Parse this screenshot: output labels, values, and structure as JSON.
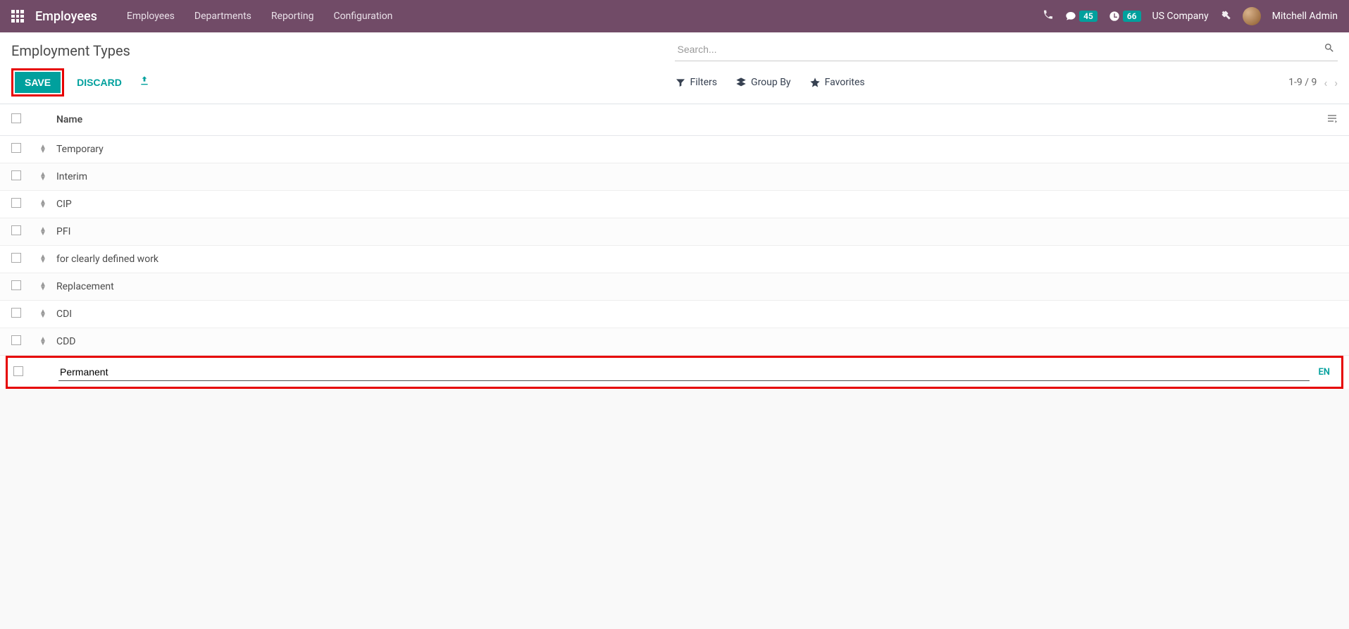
{
  "topbar": {
    "app_title": "Employees",
    "nav": [
      "Employees",
      "Departments",
      "Reporting",
      "Configuration"
    ],
    "chat_count": "45",
    "clock_count": "66",
    "company": "US Company",
    "user": "Mitchell Admin"
  },
  "control_panel": {
    "breadcrumb": "Employment Types",
    "search_placeholder": "Search...",
    "save_label": "SAVE",
    "discard_label": "DISCARD",
    "filters_label": "Filters",
    "groupby_label": "Group By",
    "favorites_label": "Favorites",
    "pager_text": "1-9 / 9"
  },
  "list": {
    "header_name": "Name",
    "rows": [
      "Temporary",
      "Interim",
      "CIP",
      "PFI",
      "for clearly defined work",
      "Replacement",
      "CDI",
      "CDD"
    ],
    "edit_value": "Permanent",
    "lang_badge": "EN"
  }
}
